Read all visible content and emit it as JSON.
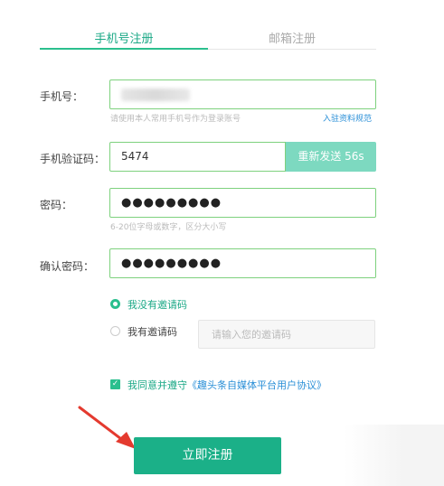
{
  "tabs": {
    "phone": "手机号注册",
    "email": "邮箱注册"
  },
  "form": {
    "phone_label": "手机号：",
    "phone_hint": "请使用本人常用手机号作为登录账号",
    "phone_link": "入驻资料规范",
    "code_label": "手机验证码：",
    "code_value": "5474",
    "resend_label": "重新发送 56s",
    "password_label": "密码：",
    "password_value": "●●●●●●●●●",
    "password_hint": "6-20位字母或数字，区分大小写",
    "confirm_label": "确认密码：",
    "confirm_value": "●●●●●●●●●"
  },
  "invite": {
    "no_code": "我没有邀请码",
    "has_code": "我有邀请码",
    "placeholder": "请输入您的邀请码"
  },
  "agreement": {
    "prefix": "我同意并遵守",
    "link": "《趣头条自媒体平台用户协议》"
  },
  "submit_label": "立即注册"
}
